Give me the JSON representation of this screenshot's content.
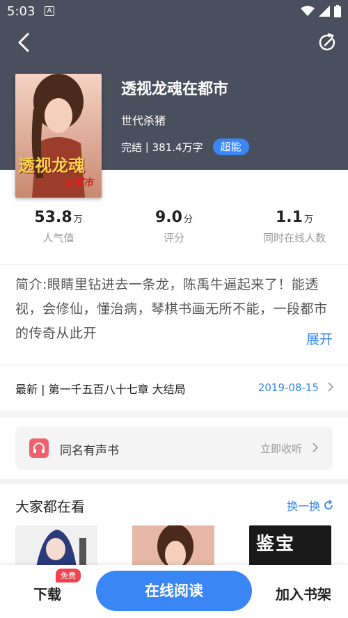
{
  "status_bar": {
    "time": "5:03",
    "notif_letter": "A"
  },
  "book": {
    "title": "透视龙魂在都市",
    "author": "世代杀猪",
    "status": "完结",
    "word_count": "381.4万字",
    "badge": "超能",
    "cover_text": "透视龙魂",
    "cover_subtext": "在都市"
  },
  "stats": [
    {
      "value": "53.8",
      "unit": "万",
      "label": "人气值"
    },
    {
      "value": "9.0",
      "unit": "分",
      "label": "评分"
    },
    {
      "value": "1.1",
      "unit": "万",
      "label": "同时在线人数"
    }
  ],
  "intro": {
    "text": "简介:眼睛里钻进去一条龙，陈禹牛逼起来了！能透视，会修仙，懂治病，琴棋书画无所不能，一段都市的传奇从此开",
    "expand_label": "展开"
  },
  "latest": {
    "label": "最新 | 第一千五百八十七章 大结局",
    "date": "2019-08-15"
  },
  "audio": {
    "title": "同名有声书",
    "action": "立即收听"
  },
  "recommend": {
    "title": "大家都在看",
    "refresh_label": "换一换",
    "book3_text": "鉴宝"
  },
  "bottom": {
    "download_label": "下载",
    "free_tag": "免费",
    "read_label": "在线阅读",
    "shelf_label": "加入书架"
  },
  "colors": {
    "accent": "#3a86f5",
    "header_bg": "#4a4f5e",
    "audio_icon": "#f0616e",
    "free_tag": "#f0434f"
  }
}
